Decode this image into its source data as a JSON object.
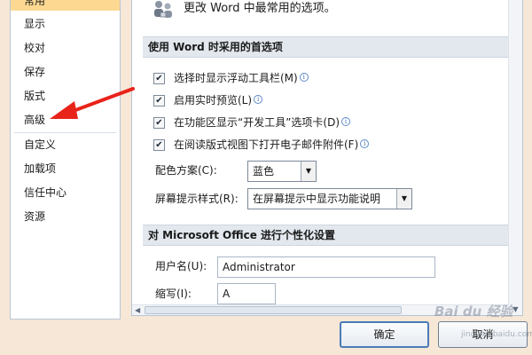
{
  "nav": {
    "items": [
      {
        "label": "常用",
        "selected": true
      },
      {
        "label": "显示"
      },
      {
        "label": "校对"
      },
      {
        "label": "保存"
      },
      {
        "label": "版式"
      },
      {
        "label": "高级"
      },
      {
        "label": "自定义"
      },
      {
        "label": "加载项"
      },
      {
        "label": "信任中心"
      },
      {
        "label": "资源"
      }
    ]
  },
  "header": {
    "text": "更改 Word 中最常用的选项。",
    "icon": "people-settings-icon"
  },
  "sections": {
    "top_options": {
      "title": "使用 Word 时采用的首选项",
      "checkboxes": [
        {
          "label": "选择时显示浮动工具栏(M)",
          "checked": true
        },
        {
          "label": "启用实时预览(L)",
          "checked": true
        },
        {
          "label": "在功能区显示“开发工具”选项卡(D)",
          "checked": true
        },
        {
          "label": "在阅读版式视图下打开电子邮件附件(F)",
          "checked": true
        }
      ],
      "color_scheme": {
        "label": "配色方案(C):",
        "value": "蓝色"
      },
      "screentip": {
        "label": "屏幕提示样式(R):",
        "value": "在屏幕提示中显示功能说明"
      }
    },
    "personalize": {
      "title": "对 Microsoft Office 进行个性化设置",
      "username": {
        "label": "用户名(U):",
        "value": "Administrator"
      },
      "initials": {
        "label": "缩写(I):",
        "value": "A"
      }
    }
  },
  "buttons": {
    "ok": "确定",
    "cancel": "取消"
  },
  "watermark": {
    "text": "Bai du 经验",
    "sub": "jingyan.baidu.com"
  },
  "colors": {
    "selected_nav": "#fcd891",
    "arrow": "#e8231a",
    "section_bg": "#e3e8ee"
  }
}
